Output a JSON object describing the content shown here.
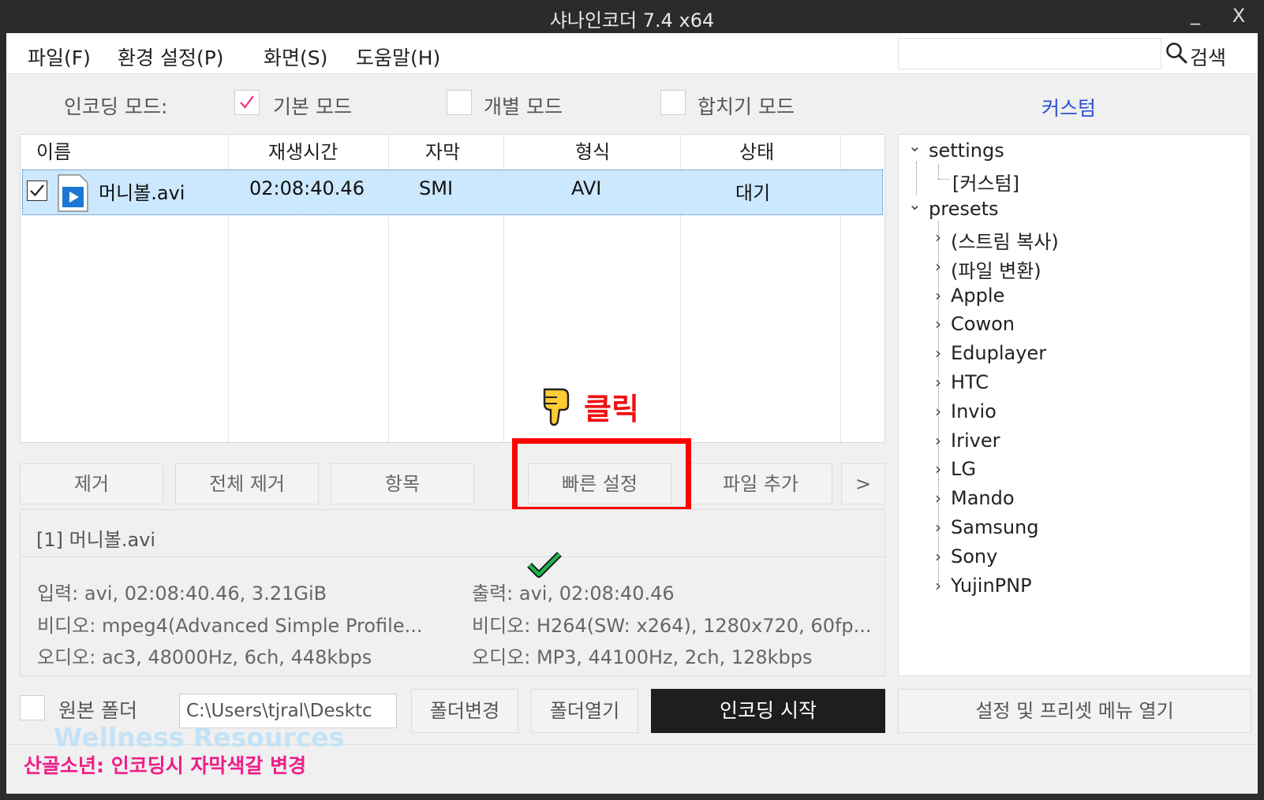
{
  "window": {
    "title": "샤나인코더  7.4 x64",
    "minimize": "_",
    "close": "X"
  },
  "menu": {
    "file": "파일(F)",
    "settings": "환경 설정(P)",
    "view": "화면(S)",
    "help": "도움말(H)",
    "search_value": "",
    "search_label": "검색"
  },
  "modes": {
    "label": "인코딩 모드:",
    "basic": "기본 모드",
    "basic_checked": true,
    "individual": "개별 모드",
    "merge": "합치기 모드",
    "custom": "커스텀"
  },
  "file_list": {
    "columns": [
      "이름",
      "재생시간",
      "자막",
      "형식",
      "상태"
    ],
    "rows": [
      {
        "checked": true,
        "name": "머니볼.avi",
        "duration": "02:08:40.46",
        "subtitle": "SMI",
        "format": "AVI",
        "status": "대기"
      }
    ]
  },
  "buttons": {
    "remove": "제거",
    "remove_all": "전체 제거",
    "items": "항목",
    "quick_settings": "빠른 설정",
    "add_file": "파일 추가",
    "more": ">"
  },
  "annotation": {
    "click_label": "클릭",
    "highlight_color": "#ff0000"
  },
  "info": {
    "title": "[1] 머니볼.avi",
    "input": "입력: avi, 02:08:40.46, 3.21GiB",
    "input_video": "비디오: mpeg4(Advanced Simple Profile...",
    "input_audio": "오디오: ac3, 48000Hz, 6ch, 448kbps",
    "output": "출력: avi, 02:08:40.46",
    "output_video": "비디오: H264(SW: x264), 1280x720, 60fp...",
    "output_audio": "오디오: MP3, 44100Hz, 2ch, 128kbps"
  },
  "tree": {
    "settings": "settings",
    "custom": "[커스텀]",
    "presets": "presets",
    "preset_items": [
      "(스트림 복사)",
      "(파일 변환)",
      "Apple",
      "Cowon",
      "Eduplayer",
      "HTC",
      "Invio",
      "Iriver",
      "LG",
      "Mando",
      "Samsung",
      "Sony",
      "YujinPNP"
    ]
  },
  "bottom": {
    "source_folder": "원본 폴더",
    "path": "C:\\Users\\tjral\\Desktc",
    "change_folder": "폴더변경",
    "open_folder": "폴더열기",
    "start_encoding": "인코딩 시작",
    "open_menu": "설정 및 프리셋 메뉴 열기"
  },
  "watermark": "Wellness Resources",
  "status": "산골소년: 인코딩시 자막색갈 변경"
}
